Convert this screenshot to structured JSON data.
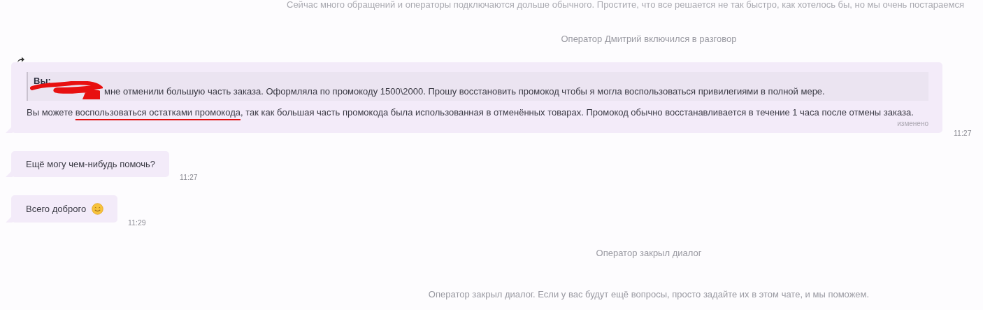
{
  "top_notice": "Сейчас много обращений и операторы подключаются дольше обычного. Простите, что все решается не так быстро, как хотелось бы, но мы очень постараемся",
  "system_top": "Оператор Дмитрий включился в разговор",
  "messages": [
    {
      "kind": "reply",
      "forwarded": true,
      "quote": {
        "author": "Вы:",
        "redacted": true,
        "text": "мне отменили большую часть заказа. Оформляла по промокоду 1500\\2000. Прошу восстановить промокод чтобы я могла воспользоваться привилегиями в полной мере."
      },
      "text_before": "Вы можете ",
      "text_underlined": "воспользоваться остатками промокода",
      "text_after": ", так как большая часть промокода была использованная в отменённых товарах. Промокод обычно восстанавливается в течение 1 часа после отмены заказа.",
      "edited_label": "изменено",
      "time": "11:27"
    },
    {
      "kind": "text",
      "text": "Ещё могу чем-нибудь помочь?",
      "emoji": false,
      "time": "11:27"
    },
    {
      "kind": "text",
      "text": "Всего доброго",
      "emoji": true,
      "time": "11:29"
    }
  ],
  "system_bottom": [
    "Оператор закрыл диалог",
    "Оператор закрыл диалог. Если у вас будут ещё вопросы, просто задайте их в этом чате, и мы поможем."
  ]
}
